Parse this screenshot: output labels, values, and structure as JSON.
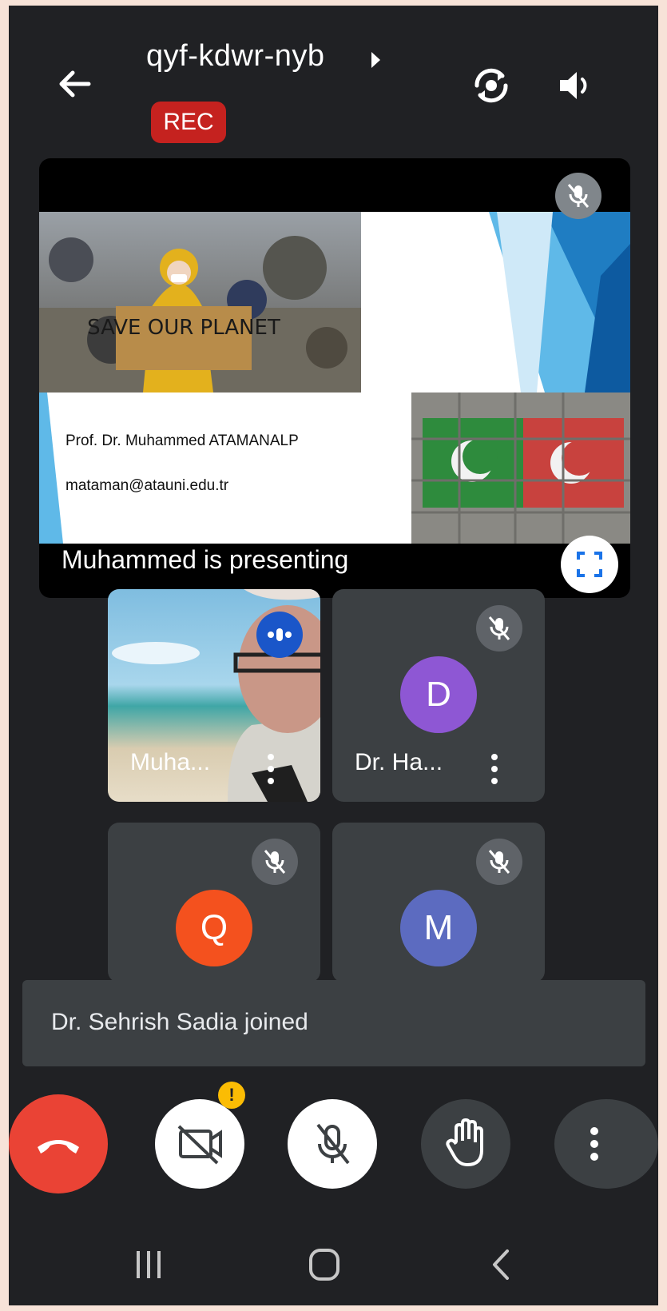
{
  "header": {
    "meeting_code": "qyf-kdwr-nyb",
    "rec_label": "REC"
  },
  "presentation": {
    "slide_poster_text": "SAVE OUR PLANET",
    "slide_name": "Prof. Dr. Muhammed ATAMANALP",
    "slide_email": "mataman@atauni.edu.tr",
    "presenting_label": "Muhammed is presenting"
  },
  "participants": [
    {
      "name": "Muha...",
      "type": "video"
    },
    {
      "name": "Dr. Ha...",
      "initial": "D",
      "color": "#8e57d4"
    },
    {
      "name": "",
      "initial": "Q",
      "color": "#f4511e"
    },
    {
      "name": "",
      "initial": "M",
      "color": "#5c6bc0"
    }
  ],
  "toast": {
    "message": "Dr. Sehrish Sadia joined"
  },
  "controls": {
    "warning_mark": "!"
  },
  "colors": {
    "background": "#202124",
    "end_call": "#ea4335",
    "rec": "#c5221f",
    "warning": "#fbbc04"
  }
}
